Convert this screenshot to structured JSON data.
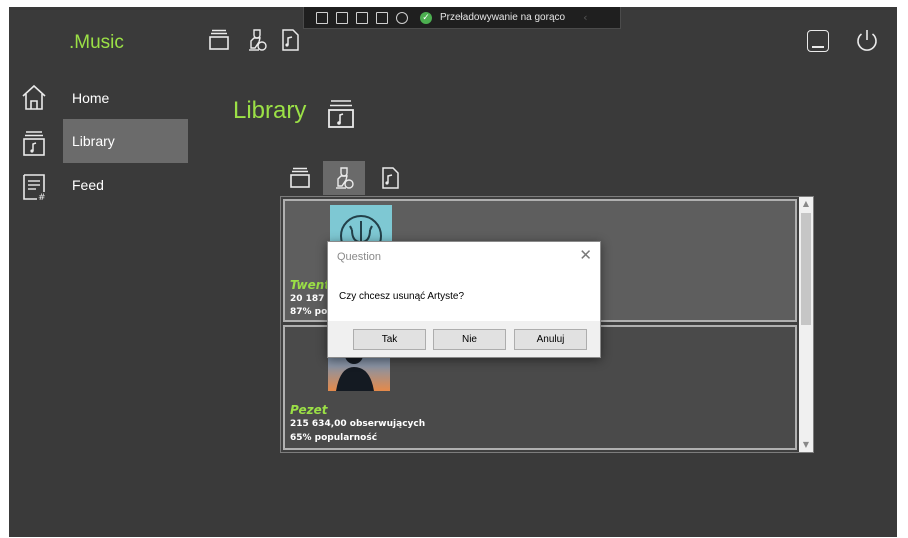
{
  "devbar": {
    "hot_reload_label": "Przeładowywanie na gorąco",
    "icons": [
      "select-element-icon",
      "display-layout-adorners-icon",
      "track-focused-element-icon",
      "bind-error-icon",
      "accessibility-icon"
    ]
  },
  "app": {
    "title": ".Music",
    "accent_color": "#9be046",
    "header_icons": [
      "artists-stack-icon",
      "artist-person-icon",
      "song-file-icon"
    ]
  },
  "sidebar": {
    "items": [
      {
        "label": "Home",
        "icon": "home-icon",
        "active": false
      },
      {
        "label": "Library",
        "icon": "library-icon",
        "active": true
      },
      {
        "label": "Feed",
        "icon": "feed-icon",
        "active": false
      }
    ]
  },
  "main": {
    "title": "Library",
    "sub_tabs": [
      {
        "icon": "albums-stack-icon",
        "active": false
      },
      {
        "icon": "artist-person-icon",
        "active": true
      },
      {
        "icon": "song-file-icon",
        "active": false
      }
    ],
    "artists": [
      {
        "name": "Twent",
        "followers": "20 187 9",
        "popularity": "87% pop",
        "selected": true,
        "thumb": "trident-logo"
      },
      {
        "name": "Pezet",
        "followers": "215 634,00 obserwujących",
        "popularity": "65% popularność",
        "selected": false,
        "thumb": "silhouette-sunset"
      }
    ]
  },
  "dialog": {
    "title": "Question",
    "message": "Czy chcesz usunąć Artyste?",
    "buttons": {
      "yes": "Tak",
      "no": "Nie",
      "cancel": "Anuluj"
    }
  }
}
